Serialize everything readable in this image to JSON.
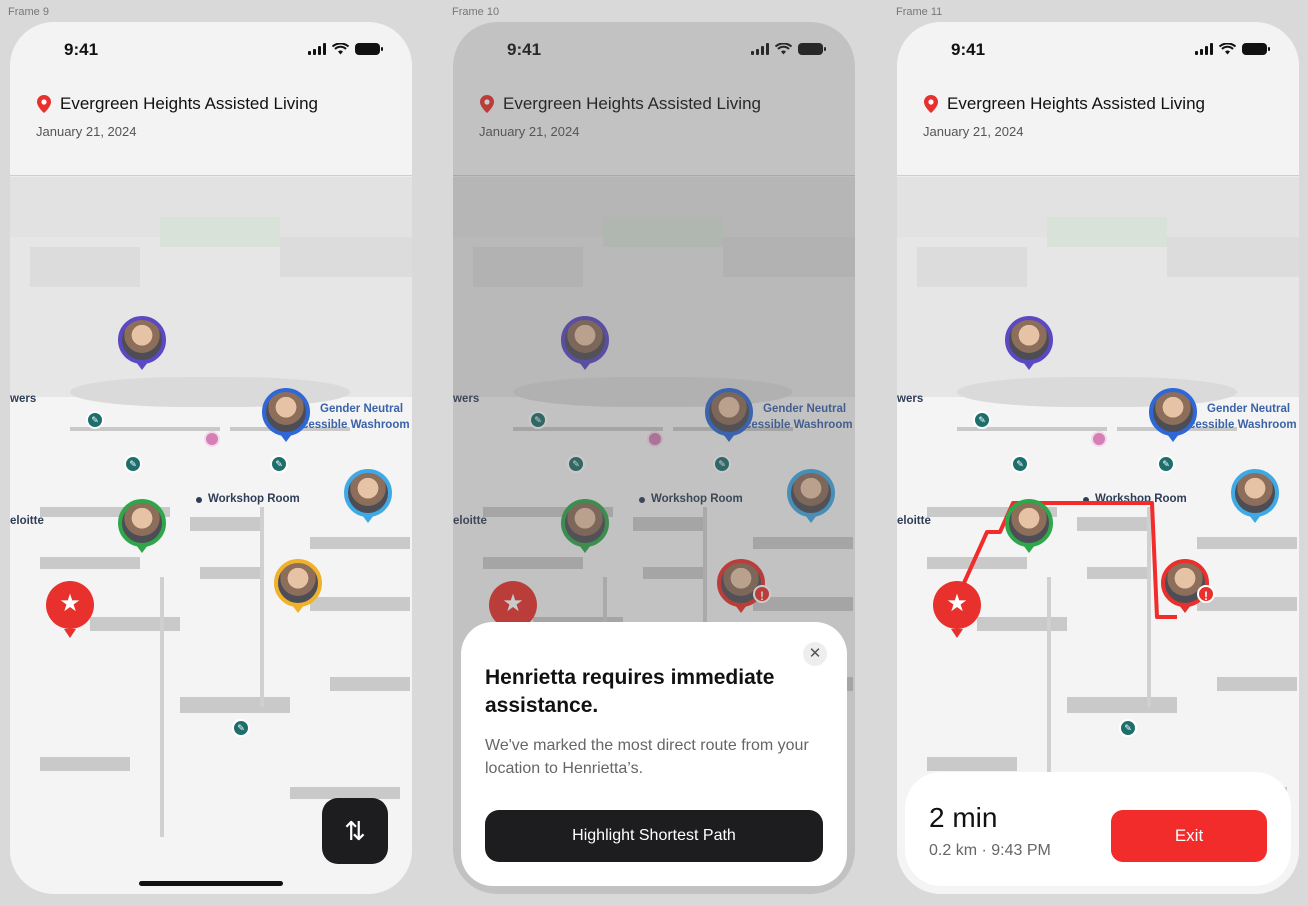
{
  "frames": [
    {
      "label": "Frame 9"
    },
    {
      "label": "Frame 10"
    },
    {
      "label": "Frame 11"
    }
  ],
  "status": {
    "time": "9:41"
  },
  "header": {
    "place": "Evergreen Heights Assisted Living",
    "date": "January 21, 2024"
  },
  "map_labels": {
    "towers": "wers",
    "gender": "Gender Neutral",
    "washroom": "cessible Washroom",
    "workshop": "Workshop Room",
    "deloitte": "eloitte"
  },
  "avatars": [
    {
      "name": "resident-purple",
      "color": "#5b49c4"
    },
    {
      "name": "resident-blue",
      "color": "#2f67d6"
    },
    {
      "name": "resident-lightblue",
      "color": "#3fa9e6"
    },
    {
      "name": "resident-green",
      "color": "#2fa64a"
    },
    {
      "name": "resident-yellow",
      "color": "#f0b12b"
    },
    {
      "name": "resident-red",
      "color": "#e8302c"
    }
  ],
  "fab": {
    "icon": "swap-vertical-icon",
    "glyph": "⇅"
  },
  "star_glyph": "★",
  "alert_glyph": "!",
  "sheet": {
    "close_glyph": "✕",
    "title": "Henrietta requires immediate assistance.",
    "body": "We've marked the most direct route from your location to Henrietta’s.",
    "cta": "Highlight Shortest Path"
  },
  "nav": {
    "eta": "2 min",
    "meta": "0.2 km · 9:43 PM",
    "exit": "Exit"
  },
  "colors": {
    "accent_red": "#e8302c",
    "route_red": "#f22b2b",
    "dark": "#1d1d1f"
  }
}
